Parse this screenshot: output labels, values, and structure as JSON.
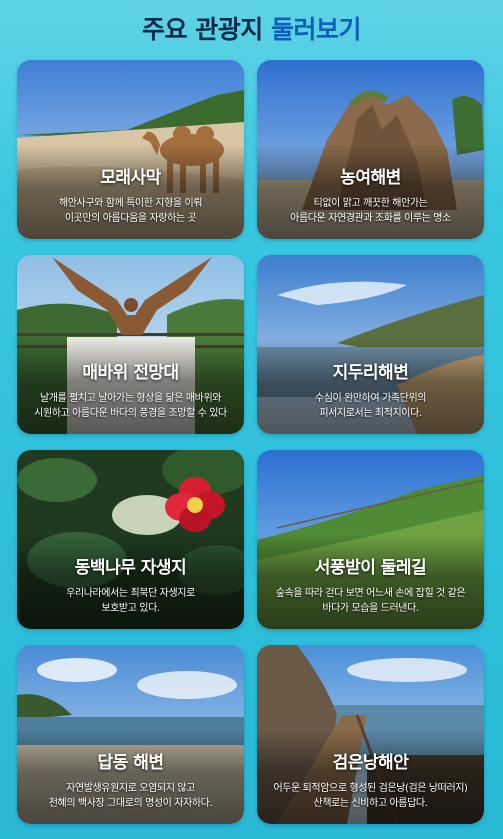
{
  "header": {
    "title_prefix": "주요 관광지 ",
    "title_accent": "둘러보기"
  },
  "attractions": [
    {
      "title": "모래사막",
      "desc": [
        "해안사구와 함께 특이한 지형을 이뤄",
        "이곳만의 아름다움을 자랑하는 곳"
      ]
    },
    {
      "title": "농여해변",
      "desc": [
        "티없이 맑고 깨끗한 해안가는",
        "아름다운 자연경관과 조화를 이루는 명소"
      ]
    },
    {
      "title": "매바위 전망대",
      "desc": [
        "날개를 펼치고 날아가는 형상을 닮은 매바위와",
        "시원하고 아름다운 바다의 풍경을 조망할 수 있다"
      ]
    },
    {
      "title": "지두리해변",
      "desc": [
        "수심이 완만하여 가족단위의",
        "피서지로서는 최적지이다."
      ]
    },
    {
      "title": "동백나무 자생지",
      "desc": [
        "우리나라에서는 최북단 자생지로",
        "보호받고 있다."
      ]
    },
    {
      "title": "서풍받이 둘레길",
      "desc": [
        "숲속을 따라 걷다 보면 어느새 손에 잡힐 것 같은",
        "바다가 모습을 드러낸다."
      ]
    },
    {
      "title": "답동 해변",
      "desc": [
        "자연발생유원지로 오염되지 않고",
        "천혜의 백사장 그대로의 명성이 자자하다."
      ]
    },
    {
      "title": "검은낭해안",
      "desc": [
        "어두운 퇴적암으로 형성된 검은낭(검은 낭떠러지)",
        "산책로는 신비하고 아름답다."
      ]
    }
  ]
}
